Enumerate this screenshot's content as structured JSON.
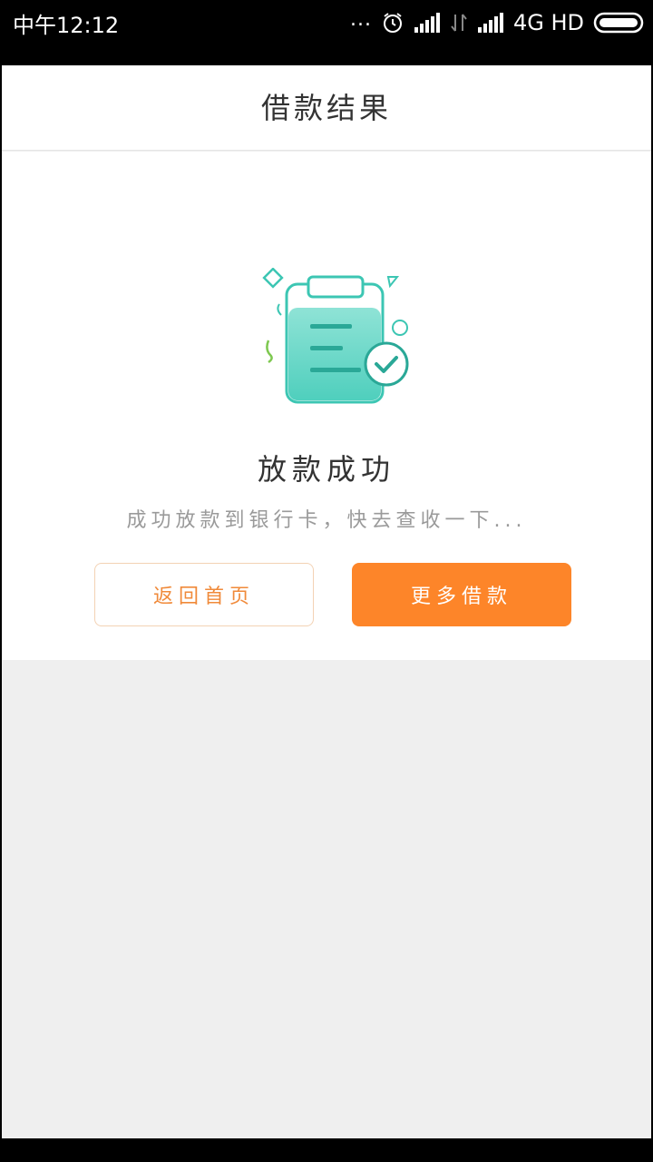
{
  "status_bar": {
    "time": "中午12:12",
    "dots": "...",
    "network": "4G HD",
    "icons": [
      "alarm-icon",
      "signal-icon",
      "data-arrows-icon",
      "signal-icon",
      "battery-icon"
    ]
  },
  "nav": {
    "title": "借款结果"
  },
  "result": {
    "illustration": "clipboard-check-icon",
    "title": "放款成功",
    "description": "成功放款到银行卡，快去查收一下..."
  },
  "buttons": {
    "home": "返回首页",
    "more": "更多借款"
  },
  "colors": {
    "accent": "#fd8529",
    "teal": "#3cc6b3",
    "background": "#efefef"
  }
}
